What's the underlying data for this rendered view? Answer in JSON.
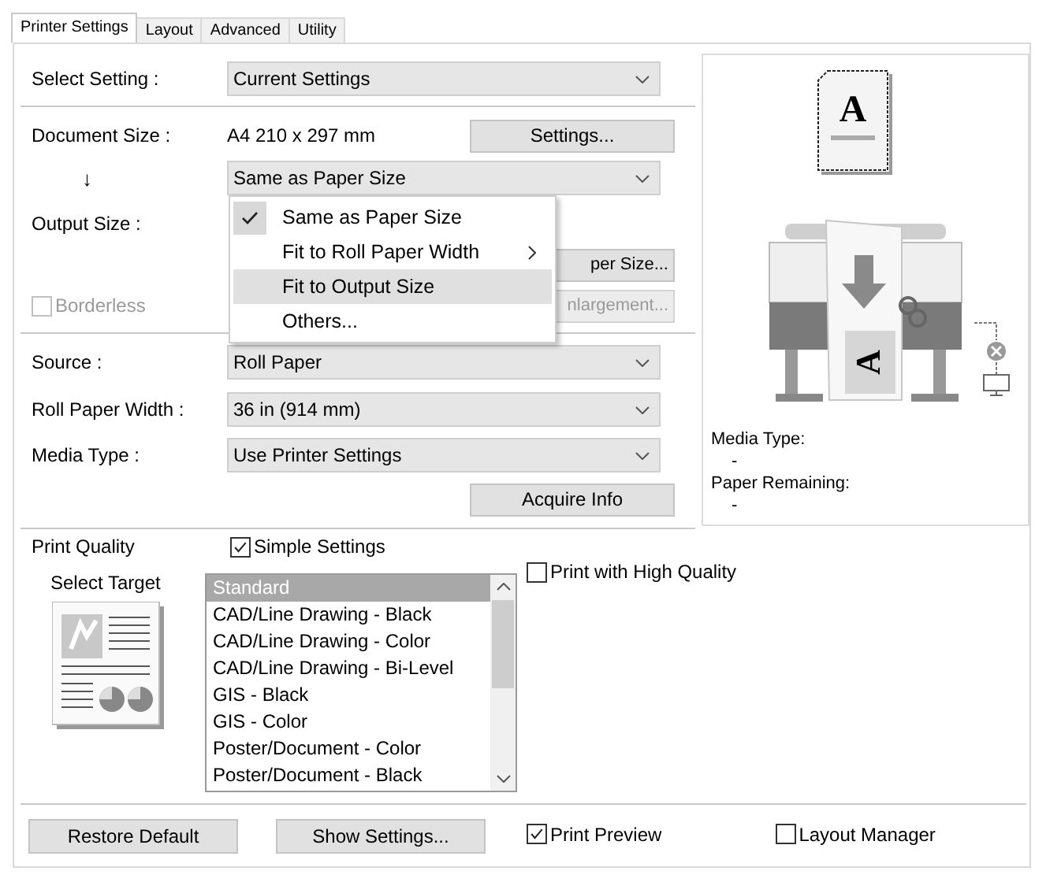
{
  "tabs": [
    {
      "label": "Printer Settings",
      "selected": true
    },
    {
      "label": "Layout",
      "selected": false
    },
    {
      "label": "Advanced",
      "selected": false
    },
    {
      "label": "Utility",
      "selected": false
    }
  ],
  "select_setting": {
    "label": "Select Setting :",
    "value": "Current Settings"
  },
  "document_size": {
    "label": "Document Size :",
    "value": "A4 210 x 297 mm",
    "button": "Settings..."
  },
  "size_arrow": "↓",
  "output_dropdown": {
    "value": "Same as Paper Size",
    "expanded": true
  },
  "output_menu": [
    {
      "label": "Same as Paper Size",
      "checked": true,
      "selected": false,
      "submenu": false
    },
    {
      "label": "Fit to Roll Paper Width",
      "checked": false,
      "selected": false,
      "submenu": true
    },
    {
      "label": "Fit to Output Size",
      "checked": false,
      "selected": true,
      "submenu": false
    },
    {
      "label": "Others...",
      "checked": false,
      "selected": false,
      "submenu": false
    }
  ],
  "output_size": {
    "label": "Output Size :",
    "button": "per Size..."
  },
  "borderless": {
    "label": "Borderless",
    "checked": false,
    "disabled": true,
    "button": "nlargement...",
    "button_disabled": true
  },
  "source": {
    "label": "Source :",
    "value": "Roll Paper"
  },
  "roll_paper_width": {
    "label": "Roll Paper Width :",
    "value": "36 in (914 mm)"
  },
  "media_type": {
    "label": "Media Type :",
    "value": "Use Printer Settings"
  },
  "acquire_button": "Acquire Info",
  "preview": {
    "page_letter": "A",
    "paper_letter": "A",
    "media_type_label": "Media Type:",
    "media_type_value": "-",
    "paper_remaining_label": "Paper Remaining:",
    "paper_remaining_value": "-"
  },
  "print_quality": {
    "label": "Print Quality",
    "simple_settings": {
      "label": "Simple Settings",
      "checked": true
    },
    "select_target": "Select Target",
    "targets": [
      {
        "label": "Standard",
        "selected": true
      },
      {
        "label": "CAD/Line Drawing - Black",
        "selected": false
      },
      {
        "label": "CAD/Line Drawing - Color",
        "selected": false
      },
      {
        "label": "CAD/Line Drawing - Bi-Level",
        "selected": false
      },
      {
        "label": "GIS - Black",
        "selected": false
      },
      {
        "label": "GIS - Color",
        "selected": false
      },
      {
        "label": "Poster/Document - Color",
        "selected": false
      },
      {
        "label": "Poster/Document - Black",
        "selected": false
      }
    ],
    "high_quality": {
      "label": "Print with High Quality",
      "checked": false
    }
  },
  "bottom": {
    "restore_button": "Restore Default",
    "show_settings_button": "Show Settings...",
    "print_preview": {
      "label": "Print Preview",
      "checked": true
    },
    "layout_manager": {
      "label": "Layout Manager",
      "checked": false
    }
  }
}
